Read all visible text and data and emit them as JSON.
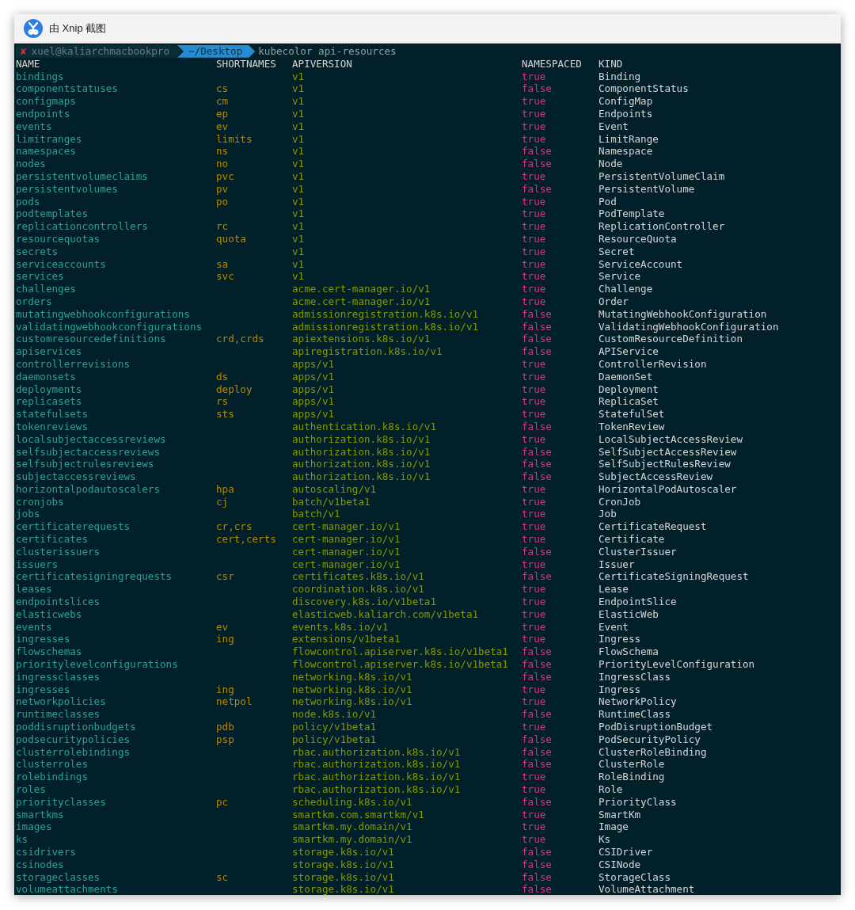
{
  "window": {
    "title": "由 Xnip 截图"
  },
  "prompt": {
    "status_mark": "✘",
    "user_host": "xuel@kaliarchmacbookpro",
    "directory": "~/Desktop",
    "command": "kubecolor api-resources"
  },
  "table": {
    "columns": [
      "NAME",
      "SHORTNAMES",
      "APIVERSION",
      "NAMESPACED",
      "KIND"
    ],
    "rows": [
      {
        "name": "bindings",
        "apiversion": "v1",
        "namespaced": "true",
        "kind": "Binding"
      },
      {
        "name": "componentstatuses",
        "shortnames": "cs",
        "apiversion": "v1",
        "namespaced": "false",
        "kind": "ComponentStatus"
      },
      {
        "name": "configmaps",
        "shortnames": "cm",
        "apiversion": "v1",
        "namespaced": "true",
        "kind": "ConfigMap"
      },
      {
        "name": "endpoints",
        "shortnames": "ep",
        "apiversion": "v1",
        "namespaced": "true",
        "kind": "Endpoints"
      },
      {
        "name": "events",
        "shortnames": "ev",
        "apiversion": "v1",
        "namespaced": "true",
        "kind": "Event"
      },
      {
        "name": "limitranges",
        "shortnames": "limits",
        "apiversion": "v1",
        "namespaced": "true",
        "kind": "LimitRange"
      },
      {
        "name": "namespaces",
        "shortnames": "ns",
        "apiversion": "v1",
        "namespaced": "false",
        "kind": "Namespace"
      },
      {
        "name": "nodes",
        "shortnames": "no",
        "apiversion": "v1",
        "namespaced": "false",
        "kind": "Node"
      },
      {
        "name": "persistentvolumeclaims",
        "shortnames": "pvc",
        "apiversion": "v1",
        "namespaced": "true",
        "kind": "PersistentVolumeClaim"
      },
      {
        "name": "persistentvolumes",
        "shortnames": "pv",
        "apiversion": "v1",
        "namespaced": "false",
        "kind": "PersistentVolume"
      },
      {
        "name": "pods",
        "shortnames": "po",
        "apiversion": "v1",
        "namespaced": "true",
        "kind": "Pod"
      },
      {
        "name": "podtemplates",
        "apiversion": "v1",
        "namespaced": "true",
        "kind": "PodTemplate"
      },
      {
        "name": "replicationcontrollers",
        "shortnames": "rc",
        "apiversion": "v1",
        "namespaced": "true",
        "kind": "ReplicationController"
      },
      {
        "name": "resourcequotas",
        "shortnames": "quota",
        "apiversion": "v1",
        "namespaced": "true",
        "kind": "ResourceQuota"
      },
      {
        "name": "secrets",
        "apiversion": "v1",
        "namespaced": "true",
        "kind": "Secret"
      },
      {
        "name": "serviceaccounts",
        "shortnames": "sa",
        "apiversion": "v1",
        "namespaced": "true",
        "kind": "ServiceAccount"
      },
      {
        "name": "services",
        "shortnames": "svc",
        "apiversion": "v1",
        "namespaced": "true",
        "kind": "Service"
      },
      {
        "name": "challenges",
        "apiversion": "acme.cert-manager.io/v1",
        "namespaced": "true",
        "kind": "Challenge"
      },
      {
        "name": "orders",
        "apiversion": "acme.cert-manager.io/v1",
        "namespaced": "true",
        "kind": "Order"
      },
      {
        "name": "mutatingwebhookconfigurations",
        "apiversion": "admissionregistration.k8s.io/v1",
        "namespaced": "false",
        "kind": "MutatingWebhookConfiguration"
      },
      {
        "name": "validatingwebhookconfigurations",
        "apiversion": "admissionregistration.k8s.io/v1",
        "namespaced": "false",
        "kind": "ValidatingWebhookConfiguration"
      },
      {
        "name": "customresourcedefinitions",
        "shortnames": "crd,crds",
        "apiversion": "apiextensions.k8s.io/v1",
        "namespaced": "false",
        "kind": "CustomResourceDefinition"
      },
      {
        "name": "apiservices",
        "apiversion": "apiregistration.k8s.io/v1",
        "namespaced": "false",
        "kind": "APIService"
      },
      {
        "name": "controllerrevisions",
        "apiversion": "apps/v1",
        "namespaced": "true",
        "kind": "ControllerRevision"
      },
      {
        "name": "daemonsets",
        "shortnames": "ds",
        "apiversion": "apps/v1",
        "namespaced": "true",
        "kind": "DaemonSet"
      },
      {
        "name": "deployments",
        "shortnames": "deploy",
        "apiversion": "apps/v1",
        "namespaced": "true",
        "kind": "Deployment"
      },
      {
        "name": "replicasets",
        "shortnames": "rs",
        "apiversion": "apps/v1",
        "namespaced": "true",
        "kind": "ReplicaSet"
      },
      {
        "name": "statefulsets",
        "shortnames": "sts",
        "apiversion": "apps/v1",
        "namespaced": "true",
        "kind": "StatefulSet"
      },
      {
        "name": "tokenreviews",
        "apiversion": "authentication.k8s.io/v1",
        "namespaced": "false",
        "kind": "TokenReview"
      },
      {
        "name": "localsubjectaccessreviews",
        "apiversion": "authorization.k8s.io/v1",
        "namespaced": "true",
        "kind": "LocalSubjectAccessReview"
      },
      {
        "name": "selfsubjectaccessreviews",
        "apiversion": "authorization.k8s.io/v1",
        "namespaced": "false",
        "kind": "SelfSubjectAccessReview"
      },
      {
        "name": "selfsubjectrulesreviews",
        "apiversion": "authorization.k8s.io/v1",
        "namespaced": "false",
        "kind": "SelfSubjectRulesReview"
      },
      {
        "name": "subjectaccessreviews",
        "apiversion": "authorization.k8s.io/v1",
        "namespaced": "false",
        "kind": "SubjectAccessReview"
      },
      {
        "name": "horizontalpodautoscalers",
        "shortnames": "hpa",
        "apiversion": "autoscaling/v1",
        "namespaced": "true",
        "kind": "HorizontalPodAutoscaler"
      },
      {
        "name": "cronjobs",
        "shortnames": "cj",
        "apiversion": "batch/v1beta1",
        "namespaced": "true",
        "kind": "CronJob"
      },
      {
        "name": "jobs",
        "apiversion": "batch/v1",
        "namespaced": "true",
        "kind": "Job"
      },
      {
        "name": "certificaterequests",
        "shortnames": "cr,crs",
        "apiversion": "cert-manager.io/v1",
        "namespaced": "true",
        "kind": "CertificateRequest"
      },
      {
        "name": "certificates",
        "shortnames": "cert,certs",
        "apiversion": "cert-manager.io/v1",
        "namespaced": "true",
        "kind": "Certificate"
      },
      {
        "name": "clusterissuers",
        "apiversion": "cert-manager.io/v1",
        "namespaced": "false",
        "kind": "ClusterIssuer"
      },
      {
        "name": "issuers",
        "apiversion": "cert-manager.io/v1",
        "namespaced": "true",
        "kind": "Issuer"
      },
      {
        "name": "certificatesigningrequests",
        "shortnames": "csr",
        "apiversion": "certificates.k8s.io/v1",
        "namespaced": "false",
        "kind": "CertificateSigningRequest"
      },
      {
        "name": "leases",
        "apiversion": "coordination.k8s.io/v1",
        "namespaced": "true",
        "kind": "Lease"
      },
      {
        "name": "endpointslices",
        "apiversion": "discovery.k8s.io/v1beta1",
        "namespaced": "true",
        "kind": "EndpointSlice"
      },
      {
        "name": "elasticwebs",
        "apiversion": "elasticweb.kaliarch.com/v1beta1",
        "namespaced": "true",
        "kind": "ElasticWeb"
      },
      {
        "name": "events",
        "shortnames": "ev",
        "apiversion": "events.k8s.io/v1",
        "namespaced": "true",
        "kind": "Event"
      },
      {
        "name": "ingresses",
        "shortnames": "ing",
        "apiversion": "extensions/v1beta1",
        "namespaced": "true",
        "kind": "Ingress"
      },
      {
        "name": "flowschemas",
        "apiversion": "flowcontrol.apiserver.k8s.io/v1beta1",
        "namespaced": "false",
        "kind": "FlowSchema"
      },
      {
        "name": "prioritylevelconfigurations",
        "apiversion": "flowcontrol.apiserver.k8s.io/v1beta1",
        "namespaced": "false",
        "kind": "PriorityLevelConfiguration"
      },
      {
        "name": "ingressclasses",
        "apiversion": "networking.k8s.io/v1",
        "namespaced": "false",
        "kind": "IngressClass"
      },
      {
        "name": "ingresses",
        "shortnames": "ing",
        "apiversion": "networking.k8s.io/v1",
        "namespaced": "true",
        "kind": "Ingress"
      },
      {
        "name": "networkpolicies",
        "shortnames": "netpol",
        "apiversion": "networking.k8s.io/v1",
        "namespaced": "true",
        "kind": "NetworkPolicy"
      },
      {
        "name": "runtimeclasses",
        "apiversion": "node.k8s.io/v1",
        "namespaced": "false",
        "kind": "RuntimeClass"
      },
      {
        "name": "poddisruptionbudgets",
        "shortnames": "pdb",
        "apiversion": "policy/v1beta1",
        "namespaced": "true",
        "kind": "PodDisruptionBudget"
      },
      {
        "name": "podsecuritypolicies",
        "shortnames": "psp",
        "apiversion": "policy/v1beta1",
        "namespaced": "false",
        "kind": "PodSecurityPolicy"
      },
      {
        "name": "clusterrolebindings",
        "apiversion": "rbac.authorization.k8s.io/v1",
        "namespaced": "false",
        "kind": "ClusterRoleBinding"
      },
      {
        "name": "clusterroles",
        "apiversion": "rbac.authorization.k8s.io/v1",
        "namespaced": "false",
        "kind": "ClusterRole"
      },
      {
        "name": "rolebindings",
        "apiversion": "rbac.authorization.k8s.io/v1",
        "namespaced": "true",
        "kind": "RoleBinding"
      },
      {
        "name": "roles",
        "apiversion": "rbac.authorization.k8s.io/v1",
        "namespaced": "true",
        "kind": "Role"
      },
      {
        "name": "priorityclasses",
        "shortnames": "pc",
        "apiversion": "scheduling.k8s.io/v1",
        "namespaced": "false",
        "kind": "PriorityClass"
      },
      {
        "name": "smartkms",
        "apiversion": "smartkm.com.smartkm/v1",
        "namespaced": "true",
        "kind": "SmartKm"
      },
      {
        "name": "images",
        "apiversion": "smartkm.my.domain/v1",
        "namespaced": "true",
        "kind": "Image"
      },
      {
        "name": "ks",
        "apiversion": "smartkm.my.domain/v1",
        "namespaced": "true",
        "kind": "Ks"
      },
      {
        "name": "csidrivers",
        "apiversion": "storage.k8s.io/v1",
        "namespaced": "false",
        "kind": "CSIDriver"
      },
      {
        "name": "csinodes",
        "apiversion": "storage.k8s.io/v1",
        "namespaced": "false",
        "kind": "CSINode"
      },
      {
        "name": "storageclasses",
        "shortnames": "sc",
        "apiversion": "storage.k8s.io/v1",
        "namespaced": "false",
        "kind": "StorageClass"
      },
      {
        "name": "volumeattachments",
        "apiversion": "storage.k8s.io/v1",
        "namespaced": "false",
        "kind": "VolumeAttachment"
      }
    ]
  }
}
